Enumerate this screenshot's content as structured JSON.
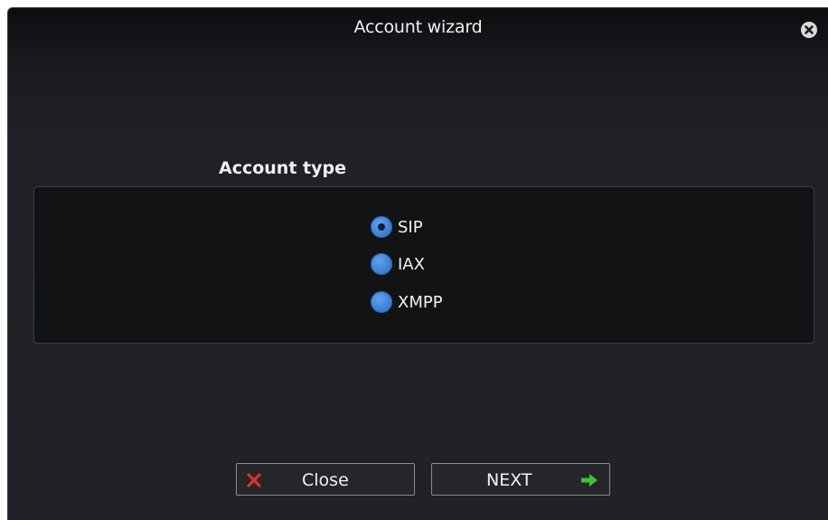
{
  "window": {
    "title": "Account wizard"
  },
  "account_type": {
    "heading": "Account type",
    "options": [
      {
        "label": "SIP",
        "selected": true
      },
      {
        "label": "IAX",
        "selected": false
      },
      {
        "label": "XMPP",
        "selected": false
      }
    ]
  },
  "buttons": {
    "close_label": "Close",
    "next_label": "NEXT"
  },
  "colors": {
    "radio_blue": "#3f82d6",
    "close_icon_red": "#e0302a",
    "next_arrow_green": "#3fc23a"
  },
  "icons": {
    "window_close": "close-circle-icon",
    "close_button": "x-icon",
    "next_button": "arrow-right-icon"
  }
}
